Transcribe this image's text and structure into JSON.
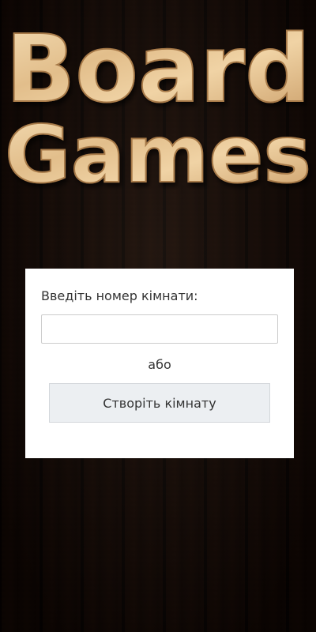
{
  "logo": {
    "line1": "Board",
    "line2": "Games"
  },
  "form": {
    "room_label": "Введіть номер кімнати:",
    "room_input_value": "",
    "room_input_placeholder": "",
    "or_text": "або",
    "create_button_label": "Створіть кімнату"
  },
  "colors": {
    "background_wood": "#3a2418",
    "logo_wood": "#e8c89a",
    "card_background": "#ffffff",
    "button_background": "#eceff2"
  }
}
